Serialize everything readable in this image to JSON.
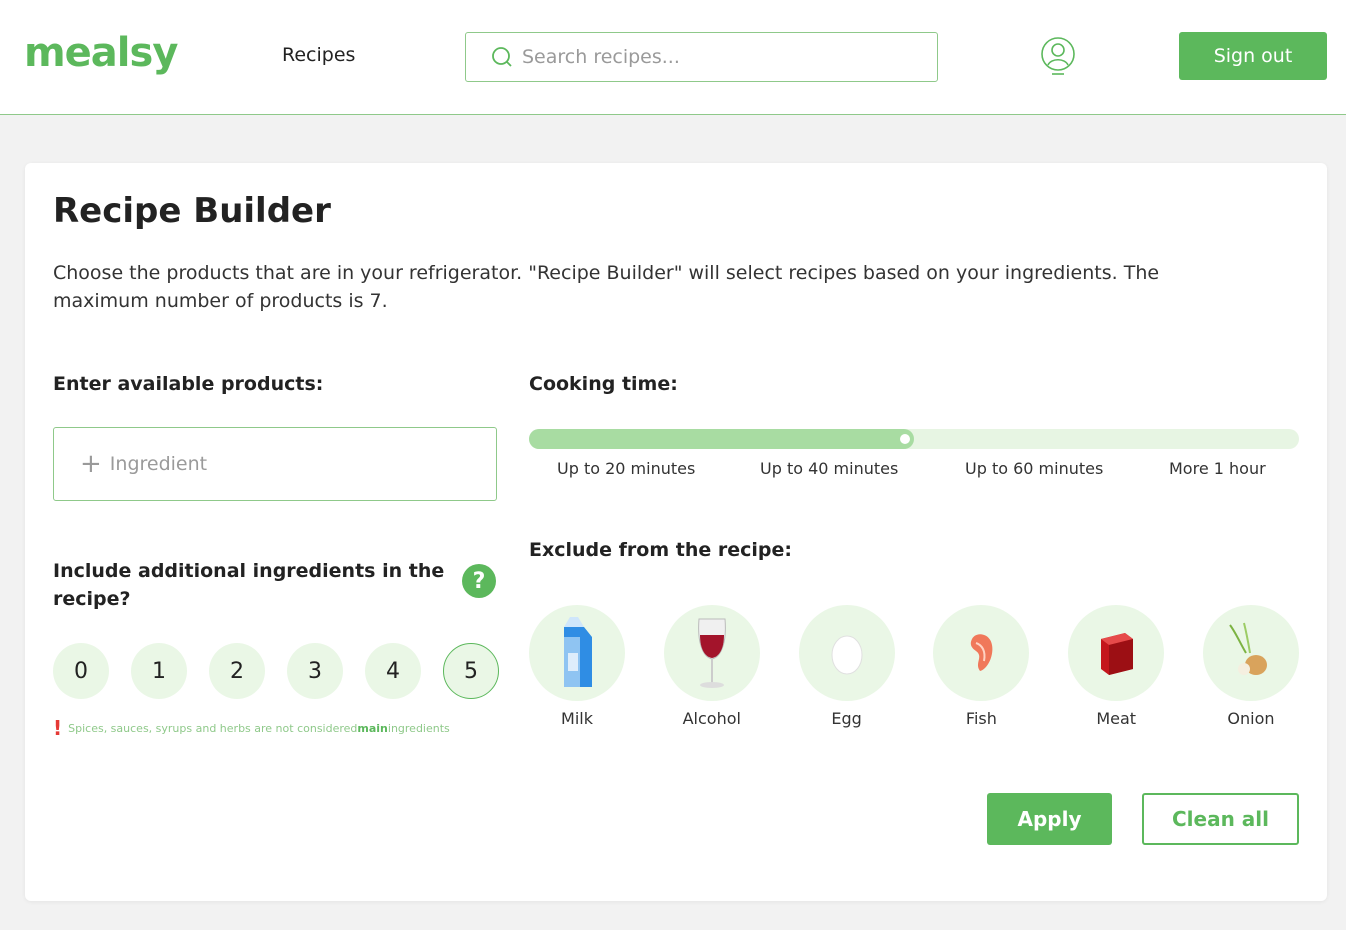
{
  "header": {
    "logo": "mealsy",
    "nav_recipes": "Recipes",
    "search_placeholder": "Search recipes...",
    "signout_label": "Sign out",
    "accent_color": "#5cb85c"
  },
  "builder": {
    "title": "Recipe Builder",
    "description": "Choose the products that are in your refrigerator. \"Recipe Builder\" will select recipes based on your ingredients. The maximum number of products is 7.",
    "products_label": "Enter available products:",
    "ingredient_placeholder": "Ingredient",
    "include_label": "Include additional ingredients in the recipe?",
    "help_icon": "?",
    "additional_options": [
      "0",
      "1",
      "2",
      "3",
      "4",
      "5"
    ],
    "additional_selected": "5",
    "note": {
      "prefix": "Spices, sauces, syrups and herbs are not considered ",
      "emphasis": "main",
      "suffix": " ingredients"
    },
    "cooking_time": {
      "label": "Cooking time:",
      "options": [
        "Up to 20 minutes",
        "Up to 40 minutes",
        "Up to 60 minutes",
        "More 1 hour"
      ],
      "selected_fraction": 0.5
    },
    "exclude": {
      "label": "Exclude from the recipe:",
      "items": [
        {
          "label": "Milk",
          "icon": "milk-carton-icon"
        },
        {
          "label": "Alcohol",
          "icon": "wine-glass-icon"
        },
        {
          "label": "Egg",
          "icon": "egg-icon"
        },
        {
          "label": "Fish",
          "icon": "salmon-steak-icon"
        },
        {
          "label": "Meat",
          "icon": "meat-cube-icon"
        },
        {
          "label": "Onion",
          "icon": "onion-icon"
        }
      ]
    },
    "apply_label": "Apply",
    "clean_label": "Clean all"
  }
}
